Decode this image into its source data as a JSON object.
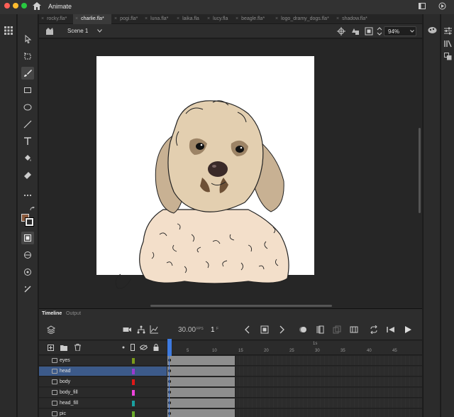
{
  "titlebar": {
    "app_name": "Animate"
  },
  "tabs": [
    {
      "label": "rocky.fla*",
      "active": false
    },
    {
      "label": "charlie.fla*",
      "active": true
    },
    {
      "label": "pogi.fla*",
      "active": false
    },
    {
      "label": "luna.fla*",
      "active": false
    },
    {
      "label": "laika.fla",
      "active": false
    },
    {
      "label": "lucy.fla",
      "active": false
    },
    {
      "label": "beagle.fla*",
      "active": false
    },
    {
      "label": "logo_dramy_dogs.fla*",
      "active": false
    },
    {
      "label": "shadow.fla*",
      "active": false
    }
  ],
  "scenebar": {
    "scene": "Scene 1",
    "zoom": "94%"
  },
  "timeline": {
    "tabs": [
      "Timeline",
      "Output"
    ],
    "fps": "30.00",
    "fps_unit": "FPS",
    "frame": "1",
    "frame_unit": "F",
    "ruler_label": "1s",
    "ruler_numbers": [
      "5",
      "10",
      "15",
      "20",
      "25",
      "30",
      "35",
      "40",
      "45"
    ],
    "layers": [
      {
        "name": "eyes",
        "color": "#7a9a1a",
        "selected": false
      },
      {
        "name": "head",
        "color": "#9b3ad0",
        "selected": true
      },
      {
        "name": "body",
        "color": "#e01818",
        "selected": false
      },
      {
        "name": "body_fill",
        "color": "#ee44dd",
        "selected": false
      },
      {
        "name": "head_fill",
        "color": "#1aa0a0",
        "selected": false
      },
      {
        "name": "pic",
        "color": "#6aaa2a",
        "selected": false
      }
    ]
  },
  "colors": {
    "accent": "#3d7ae0",
    "stroke_color": "#000000",
    "fill_color": "#8b5a3c"
  }
}
